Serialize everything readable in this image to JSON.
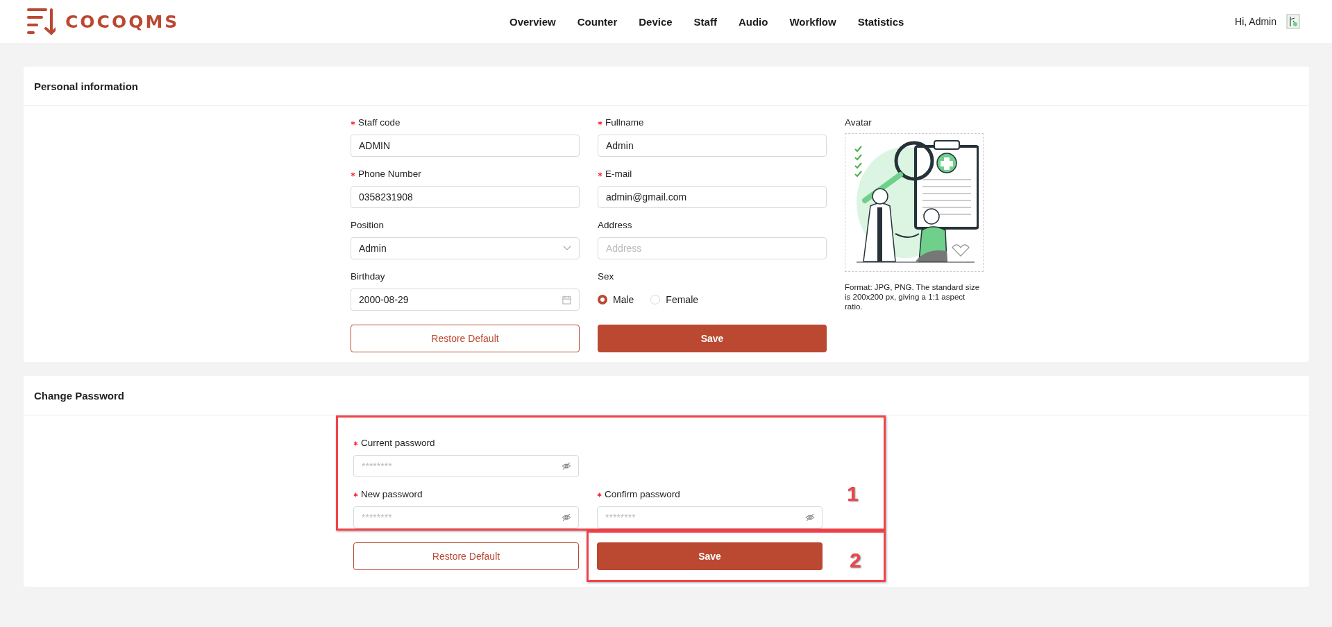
{
  "header": {
    "logo": "COCOQMS",
    "nav": [
      {
        "label": "Overview"
      },
      {
        "label": "Counter"
      },
      {
        "label": "Device"
      },
      {
        "label": "Staff"
      },
      {
        "label": "Audio"
      },
      {
        "label": "Workflow"
      },
      {
        "label": "Statistics"
      }
    ],
    "greeting": "Hi, Admin"
  },
  "personal_information": {
    "title": "Personal information",
    "fields": [
      {
        "kind": "text",
        "label": "Staff code",
        "required": true,
        "value": "ADMIN"
      },
      {
        "kind": "text",
        "label": "Fullname",
        "required": true,
        "value": "Admin"
      },
      {
        "kind": "text",
        "label": "Phone Number",
        "required": true,
        "value": "0358231908"
      },
      {
        "kind": "text",
        "label": "E-mail",
        "required": true,
        "value": "admin@gmail.com"
      },
      {
        "kind": "select",
        "label": "Position",
        "required": false,
        "value": "Admin"
      },
      {
        "kind": "text",
        "label": "Address",
        "required": false,
        "placeholder": "Address"
      },
      {
        "kind": "date",
        "label": "Birthday",
        "required": false,
        "value": "2000-08-29"
      },
      {
        "kind": "radio",
        "label": "Sex",
        "required": false,
        "options": [
          {
            "label": "Male",
            "selected": true
          },
          {
            "label": "Female",
            "selected": false
          }
        ]
      }
    ],
    "avatar": {
      "label": "Avatar",
      "note": "Format: JPG, PNG. The standard size is 200x200 px, giving a 1:1 aspect ratio."
    },
    "buttons": [
      {
        "kind": "secondary",
        "label": "Restore Default"
      },
      {
        "kind": "primary",
        "label": "Save"
      }
    ]
  },
  "change_password": {
    "title": "Change Password",
    "rows": [
      [
        {
          "label": "Current password",
          "required": true,
          "placeholder": "********"
        }
      ],
      [
        {
          "label": "New password",
          "required": true,
          "placeholder": "********"
        },
        {
          "label": "Confirm password",
          "required": true,
          "placeholder": "********"
        }
      ]
    ],
    "buttons": [
      {
        "kind": "secondary",
        "label": "Restore Default"
      },
      {
        "kind": "primary",
        "label": "Save"
      }
    ]
  },
  "annotations": [
    {
      "label": "1"
    },
    {
      "label": "2"
    }
  ]
}
